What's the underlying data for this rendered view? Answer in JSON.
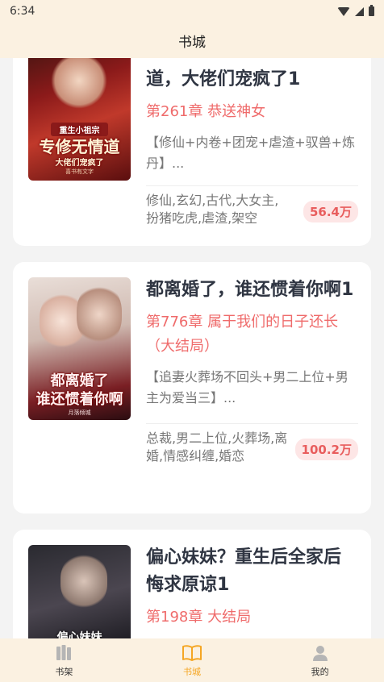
{
  "status": {
    "time": "6:34"
  },
  "header": {
    "title": "书城"
  },
  "books": [
    {
      "title": "道，大佬们宠疯了1",
      "chapter": "第261章 恭送神女",
      "desc": "【修仙+内卷+团宠+虐渣+驭兽+炼丹】...",
      "tags": "修仙,玄幻,古代,大女主,扮猪吃虎,虐渣,架空",
      "count": "56.4万",
      "cover": {
        "line1": "重生小祖宗",
        "line2": "专修无情道",
        "line3": "大佬们宠疯了",
        "line4": "喜书有文字"
      }
    },
    {
      "title": "都离婚了，谁还惯着你啊1",
      "chapter": "第776章 属于我们的日子还长（大结局）",
      "desc": "【追妻火葬场不回头+男二上位+男主为爱当三】...",
      "tags": "总裁,男二上位,火葬场,离婚,情感纠缠,婚恋",
      "count": "100.2万",
      "cover": {
        "line1": "都离婚了",
        "line2": "谁还惯着你啊",
        "line3": "月落倾城"
      }
    },
    {
      "title": "偏心妹妹？重生后全家后悔求原谅1",
      "chapter": "第198章 大结局",
      "cover": {
        "line1": "偏心妹妹"
      }
    }
  ],
  "tabbar": [
    {
      "label": "书架",
      "icon": "bookshelf-icon"
    },
    {
      "label": "书城",
      "icon": "book-open-icon",
      "active": true
    },
    {
      "label": "我的",
      "icon": "user-icon"
    }
  ],
  "colors": {
    "accent": "#f5a623",
    "chapter": "#ef6b6b",
    "count_bg": "#fde6e6",
    "header_bg": "#fbf1e1"
  }
}
